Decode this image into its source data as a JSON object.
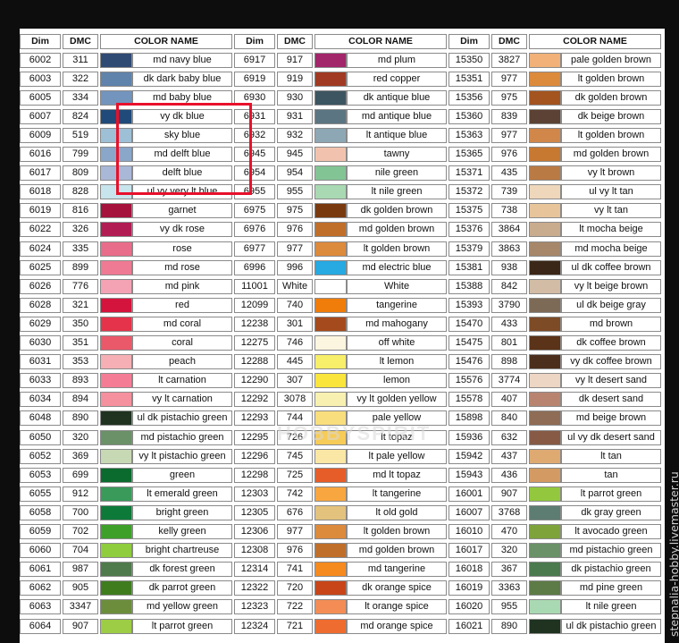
{
  "headers": [
    "Dim",
    "DMC",
    "COLOR NAME"
  ],
  "columns": [
    [
      [
        "6002",
        "311",
        "md navy blue",
        "#2f4a73"
      ],
      [
        "6003",
        "322",
        "dk dark baby blue",
        "#5f83ab"
      ],
      [
        "6005",
        "334",
        "md baby blue",
        "#7394bd"
      ],
      [
        "6007",
        "824",
        "vy dk blue",
        "#1f4a79"
      ],
      [
        "6009",
        "519",
        "sky blue",
        "#9dc0d6"
      ],
      [
        "6016",
        "799",
        "md delft blue",
        "#8aa6c9"
      ],
      [
        "6017",
        "809",
        "delft blue",
        "#aab8d8"
      ],
      [
        "6018",
        "828",
        "ul vy very lt blue",
        "#c8e4ec"
      ],
      [
        "6019",
        "816",
        "garnet",
        "#a5123c"
      ],
      [
        "6022",
        "326",
        "vy dk rose",
        "#b11c52"
      ],
      [
        "6024",
        "335",
        "rose",
        "#e86d8a"
      ],
      [
        "6025",
        "899",
        "md rose",
        "#ef7a93"
      ],
      [
        "6026",
        "776",
        "md pink",
        "#f3a3b4"
      ],
      [
        "6028",
        "321",
        "red",
        "#d4143c"
      ],
      [
        "6029",
        "350",
        "md coral",
        "#e4334a"
      ],
      [
        "6030",
        "351",
        "coral",
        "#e9596a"
      ],
      [
        "6031",
        "353",
        "peach",
        "#f6b0b5"
      ],
      [
        "6033",
        "893",
        "lt carnation",
        "#f57c95"
      ],
      [
        "6034",
        "894",
        "vy lt carnation",
        "#f5909e"
      ],
      [
        "6048",
        "890",
        "ul dk pistachio green",
        "#1f3320"
      ],
      [
        "6050",
        "320",
        "md pistachio green",
        "#6a9168"
      ],
      [
        "6052",
        "369",
        "vy lt pistachio green",
        "#c7d9b4"
      ],
      [
        "6053",
        "699",
        "green",
        "#0b6b2e"
      ],
      [
        "6055",
        "912",
        "lt emerald green",
        "#3a9a5a"
      ],
      [
        "6058",
        "700",
        "bright green",
        "#0e7a3a"
      ],
      [
        "6059",
        "702",
        "kelly green",
        "#3ea029"
      ],
      [
        "6060",
        "704",
        "bright chartreuse",
        "#8fcc3e"
      ],
      [
        "6061",
        "987",
        "dk forest green",
        "#4f7a4b"
      ],
      [
        "6062",
        "905",
        "dk parrot green",
        "#3f7c1e"
      ],
      [
        "6063",
        "3347",
        "md yellow green",
        "#6c8e3c"
      ],
      [
        "6064",
        "907",
        "lt parrot green",
        "#9dcc45"
      ]
    ],
    [
      [
        "6917",
        "917",
        "md plum",
        "#a2266a"
      ],
      [
        "6919",
        "919",
        "red copper",
        "#a13a22"
      ],
      [
        "6930",
        "930",
        "dk antique blue",
        "#3d5560"
      ],
      [
        "6931",
        "931",
        "md antique blue",
        "#5b7582"
      ],
      [
        "6932",
        "932",
        "lt antique blue",
        "#8ea7b4"
      ],
      [
        "6945",
        "945",
        "tawny",
        "#f1c3ae"
      ],
      [
        "6954",
        "954",
        "nile green",
        "#83c495"
      ],
      [
        "6955",
        "955",
        "lt nile green",
        "#a9d9b2"
      ],
      [
        "6975",
        "975",
        "dk golden brown",
        "#7a3a10"
      ],
      [
        "6976",
        "976",
        "md golden brown",
        "#c06f2a"
      ],
      [
        "6977",
        "977",
        "lt golden brown",
        "#dc8a3c"
      ],
      [
        "6996",
        "996",
        "md electric blue",
        "#27a9e1"
      ],
      [
        "11001",
        "White",
        "White",
        "#ffffff"
      ],
      [
        "12099",
        "740",
        "tangerine",
        "#f07c09"
      ],
      [
        "12238",
        "301",
        "md mahogany",
        "#a54a1c"
      ],
      [
        "12275",
        "746",
        "off white",
        "#fcf5df"
      ],
      [
        "12288",
        "445",
        "lt lemon",
        "#f7ee6a"
      ],
      [
        "12290",
        "307",
        "lemon",
        "#f9e53c"
      ],
      [
        "12292",
        "3078",
        "vy lt golden yellow",
        "#f8f0b0"
      ],
      [
        "12293",
        "744",
        "pale yellow",
        "#f9de7d"
      ],
      [
        "12295",
        "726",
        "lt topaz",
        "#f6cb57"
      ],
      [
        "12296",
        "745",
        "lt pale yellow",
        "#fae6a5"
      ],
      [
        "12298",
        "725",
        "md lt topaz",
        "#e65d2a"
      ],
      [
        "12303",
        "742",
        "lt tangerine",
        "#f8a640"
      ],
      [
        "12305",
        "676",
        "lt old gold",
        "#e3c27d"
      ],
      [
        "12306",
        "977",
        "lt golden brown",
        "#dc8a3c"
      ],
      [
        "12308",
        "976",
        "md golden brown",
        "#c06f2a"
      ],
      [
        "12314",
        "741",
        "md tangerine",
        "#f58a1f"
      ],
      [
        "12322",
        "720",
        "dk orange spice",
        "#c8451a"
      ],
      [
        "12323",
        "722",
        "lt orange spice",
        "#f38d55"
      ],
      [
        "12324",
        "721",
        "md orange spice",
        "#ee6c2f"
      ]
    ],
    [
      [
        "15350",
        "3827",
        "pale golden brown",
        "#f1b178"
      ],
      [
        "15351",
        "977",
        "lt golden brown",
        "#dc8a3c"
      ],
      [
        "15356",
        "975",
        "dk golden brown",
        "#a4541f"
      ],
      [
        "15360",
        "839",
        "dk beige brown",
        "#5c4234"
      ],
      [
        "15363",
        "977",
        "lt golden brown",
        "#d2874a"
      ],
      [
        "15365",
        "976",
        "md golden brown",
        "#c77831"
      ],
      [
        "15371",
        "435",
        "vy lt brown",
        "#ba7a44"
      ],
      [
        "15372",
        "739",
        "ul vy lt tan",
        "#efd7bb"
      ],
      [
        "15375",
        "738",
        "vy lt tan",
        "#e7c49a"
      ],
      [
        "15376",
        "3864",
        "lt mocha beige",
        "#c9ab8e"
      ],
      [
        "15379",
        "3863",
        "md mocha beige",
        "#a68769"
      ],
      [
        "15381",
        "938",
        "ul dk coffee brown",
        "#3a2717"
      ],
      [
        "15388",
        "842",
        "vy lt beige brown",
        "#d2bca5"
      ],
      [
        "15393",
        "3790",
        "ul dk beige gray",
        "#7d6a56"
      ],
      [
        "15470",
        "433",
        "md brown",
        "#7d4b26"
      ],
      [
        "15475",
        "801",
        "dk coffee brown",
        "#5b3318"
      ],
      [
        "15476",
        "898",
        "vy dk coffee brown",
        "#4c2e1c"
      ],
      [
        "15576",
        "3774",
        "vy lt desert sand",
        "#eed6c4"
      ],
      [
        "15578",
        "407",
        "dk desert sand",
        "#b88470"
      ],
      [
        "15898",
        "840",
        "md beige brown",
        "#8f6c55"
      ],
      [
        "15936",
        "632",
        "ul vy dk desert sand",
        "#875a46"
      ],
      [
        "15942",
        "437",
        "lt tan",
        "#dfaa72"
      ],
      [
        "15943",
        "436",
        "tan",
        "#d39b63"
      ],
      [
        "16001",
        "907",
        "lt parrot green",
        "#93c83e"
      ],
      [
        "16007",
        "3768",
        "dk gray green",
        "#5e7d72"
      ],
      [
        "16010",
        "470",
        "lt avocado green",
        "#7ea33b"
      ],
      [
        "16017",
        "320",
        "md pistachio green",
        "#6a9168"
      ],
      [
        "16018",
        "367",
        "dk pistachio green",
        "#4a7a4e"
      ],
      [
        "16019",
        "3363",
        "md pine green",
        "#5d7b46"
      ],
      [
        "16020",
        "955",
        "lt nile green",
        "#a9d9b2"
      ],
      [
        "16021",
        "890",
        "ul dk pistachio green",
        "#1f3320"
      ]
    ]
  ],
  "watermark_center": "HOBBYSPIRIT",
  "watermark_side": "stepnalia-hobby.livemaster.ru"
}
